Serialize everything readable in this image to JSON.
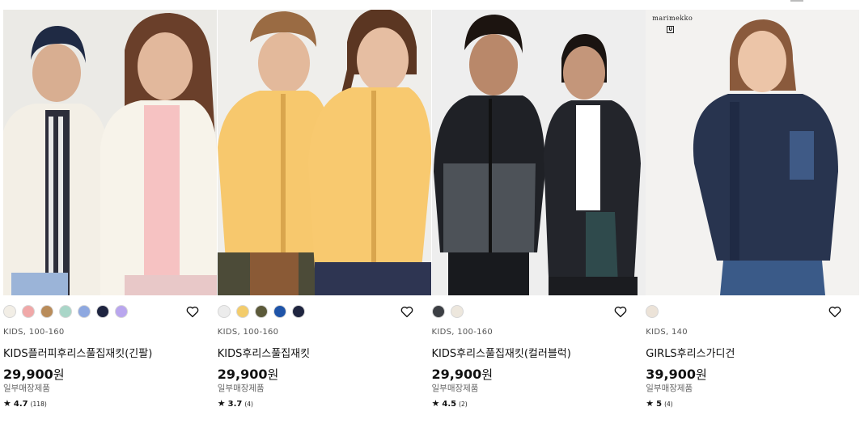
{
  "products": [
    {
      "swatches": [
        "#f2eee6",
        "#f0a8a8",
        "#b98c5a",
        "#a9d6c8",
        "#8ea8e0",
        "#1e2440",
        "#b9a6ee"
      ],
      "meta": "KIDS, 100-160",
      "name": "KIDS플러피후리스풀집재킷(긴팔)",
      "price": "29,900",
      "currency": "원",
      "note": "일부매장제품",
      "rating": "4.7",
      "reviews": "(118)",
      "image_alt": "Two children wearing white fluffy fleece full-zip jackets"
    },
    {
      "swatches": [
        "#ececec",
        "#f3cc6b",
        "#5c5a3a",
        "#1f54a8",
        "#1f2540"
      ],
      "meta": "KIDS, 100-160",
      "name": "KIDS후리스풀집재킷",
      "price": "29,900",
      "currency": "원",
      "note": "일부매장제품",
      "rating": "3.7",
      "reviews": "(4)",
      "image_alt": "Two children wearing yellow fleece full-zip jackets"
    },
    {
      "swatches": [
        "#3c3f44",
        "#ede7dd"
      ],
      "meta": "KIDS, 100-160",
      "name": "KIDS후리스풀집재킷(컬러블럭)",
      "price": "29,900",
      "currency": "원",
      "note": "일부매장제품",
      "rating": "4.5",
      "reviews": "(2)",
      "image_alt": "Two children wearing black and grey color block fleece jackets"
    },
    {
      "swatches": [
        "#ece3d8"
      ],
      "meta": "KIDS, 140",
      "name": "GIRLS후리스가디건",
      "price": "39,900",
      "currency": "원",
      "note": "일부매장제품",
      "rating": "5",
      "reviews": "(4)",
      "brand": "marimekko",
      "image_alt": "Girl wearing a navy fleece cardigan"
    }
  ],
  "icons": {
    "favorite": "heart-outline-icon",
    "rating": "star-icon"
  }
}
